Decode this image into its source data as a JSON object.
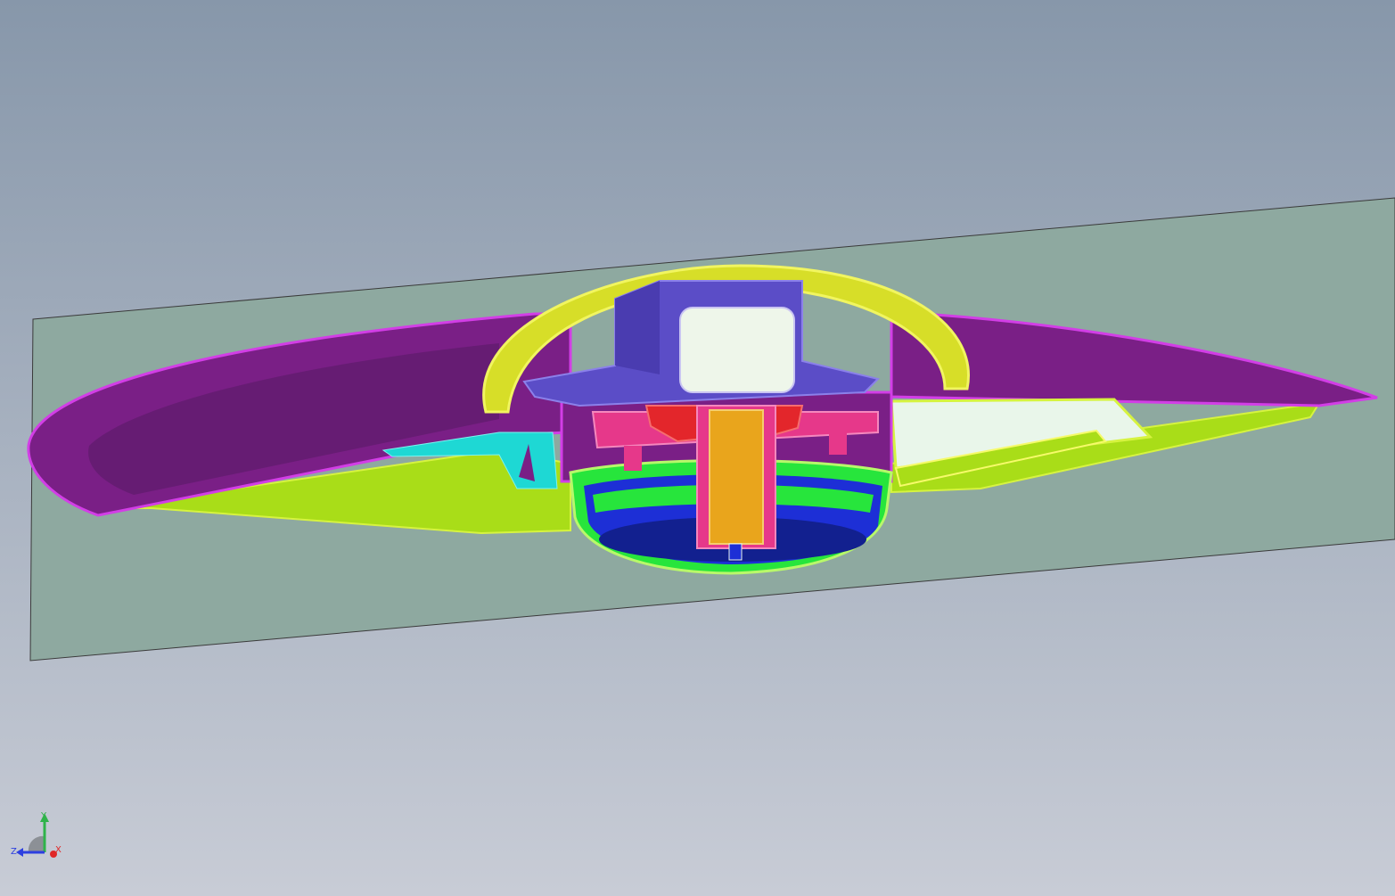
{
  "viewport": {
    "background_top": "#8797aa",
    "background_bottom": "#c8ccd6"
  },
  "model": {
    "section_plane_color": "#8ea9a0",
    "parts": [
      {
        "name": "outer-shell",
        "color": "#7a1f86"
      },
      {
        "name": "outer-shell-edge",
        "color": "#d23ee6"
      },
      {
        "name": "dome-cover",
        "color": "#d7de28"
      },
      {
        "name": "motor-bracket",
        "color": "#5b4dc7"
      },
      {
        "name": "motor-block",
        "color": "#eef6ea"
      },
      {
        "name": "center-hub",
        "color": "#e3262b"
      },
      {
        "name": "shaft",
        "color": "#e9a51c"
      },
      {
        "name": "pink-mount",
        "color": "#e6388a"
      },
      {
        "name": "fan-housing",
        "color": "#27e53c"
      },
      {
        "name": "fan-blades",
        "color": "#1d2fd6"
      },
      {
        "name": "lower-tray",
        "color": "#a9dd18"
      },
      {
        "name": "cyan-clip",
        "color": "#1ed8d4"
      },
      {
        "name": "white-board",
        "color": "#e9f6ea"
      }
    ]
  },
  "triad": {
    "axes": {
      "y": {
        "label": "Y",
        "color": "#2fb34a"
      },
      "z": {
        "label": "Z",
        "color": "#2c3fe0"
      },
      "x": {
        "label": "X",
        "color": "#e02828"
      }
    }
  }
}
